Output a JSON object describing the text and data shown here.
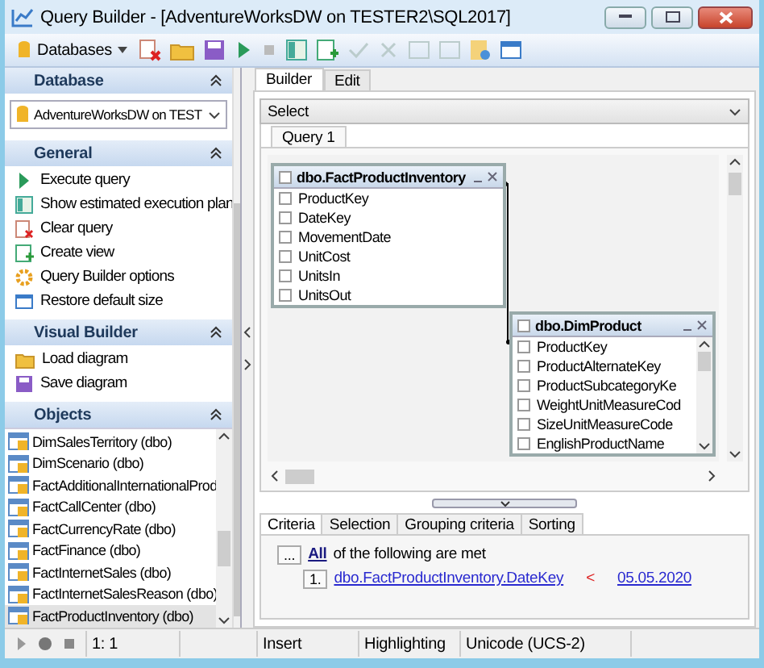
{
  "window": {
    "title": "Query Builder - [AdventureWorksDW on TESTER2\\SQL2017]"
  },
  "toolbar": {
    "databases_label": "Databases"
  },
  "sidebar": {
    "sections": [
      {
        "kind": "database",
        "title": "Database",
        "value": "AdventureWorksDW on TEST"
      },
      {
        "kind": "actions",
        "title": "General",
        "items": [
          "Execute query",
          "Show estimated execution plan",
          "Clear query",
          "Create view",
          "Query Builder options",
          "Restore default size"
        ]
      },
      {
        "kind": "actions",
        "title": "Visual Builder",
        "items": [
          "Load diagram",
          "Save diagram"
        ]
      },
      {
        "kind": "objects",
        "title": "Objects",
        "items": [
          {
            "label": "DimSalesTerritory (dbo)",
            "selected": false
          },
          {
            "label": "DimScenario (dbo)",
            "selected": false
          },
          {
            "label": "FactAdditionalInternationalProd",
            "selected": false
          },
          {
            "label": "FactCallCenter (dbo)",
            "selected": false
          },
          {
            "label": "FactCurrencyRate (dbo)",
            "selected": false
          },
          {
            "label": "FactFinance (dbo)",
            "selected": false
          },
          {
            "label": "FactInternetSales (dbo)",
            "selected": false
          },
          {
            "label": "FactInternetSalesReason (dbo)",
            "selected": false
          },
          {
            "label": "FactProductInventory (dbo)",
            "selected": true
          }
        ]
      }
    ]
  },
  "tabs": [
    {
      "label": "Builder",
      "selected": true
    },
    {
      "label": "Edit",
      "selected": false
    }
  ],
  "query_type": "Select",
  "query_tabs": [
    {
      "label": "Query 1",
      "selected": true
    }
  ],
  "diagram": {
    "tables": [
      {
        "name": "dbo.FactProductInventory",
        "checked": false,
        "fields": [
          {
            "name": "ProductKey",
            "checked": false
          },
          {
            "name": "DateKey",
            "checked": false
          },
          {
            "name": "MovementDate",
            "checked": false
          },
          {
            "name": "UnitCost",
            "checked": false
          },
          {
            "name": "UnitsIn",
            "checked": false
          },
          {
            "name": "UnitsOut",
            "checked": false
          }
        ]
      },
      {
        "name": "dbo.DimProduct",
        "checked": false,
        "fields": [
          {
            "name": "ProductKey",
            "checked": false
          },
          {
            "name": "ProductAlternateKey",
            "checked": false
          },
          {
            "name": "ProductSubcategoryKe",
            "checked": false
          },
          {
            "name": "WeightUnitMeasureCod",
            "checked": false
          },
          {
            "name": "SizeUnitMeasureCode",
            "checked": false
          },
          {
            "name": "EnglishProductName",
            "checked": false
          }
        ]
      }
    ]
  },
  "criteria_tabs": [
    {
      "label": "Criteria",
      "selected": true
    },
    {
      "label": "Selection",
      "selected": false
    },
    {
      "label": "Grouping criteria",
      "selected": false
    },
    {
      "label": "Sorting",
      "selected": false
    }
  ],
  "criteria": {
    "menu_button": "...",
    "quantifier": "All",
    "text": "of the following are met",
    "conditions": [
      {
        "number": "1.",
        "field": "dbo.FactProductInventory.DateKey",
        "operator": "<",
        "value": "05.05.2020"
      }
    ]
  },
  "status_bar": {
    "position": "1:  1",
    "mode": "Insert",
    "highlighting": "Highlighting",
    "encoding": "Unicode (UCS-2)"
  }
}
